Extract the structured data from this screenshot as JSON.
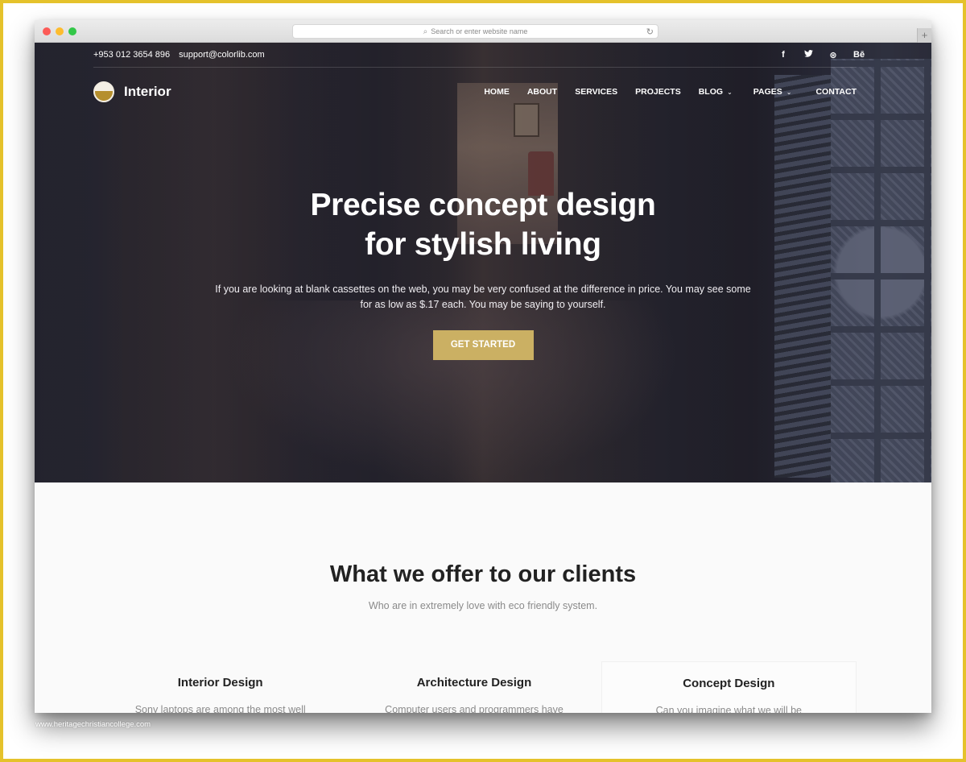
{
  "browser": {
    "url_placeholder": "Search or enter website name",
    "search_icon": "search-icon",
    "reload_icon": "reload-icon",
    "new_tab_label": "+"
  },
  "topbar": {
    "phone": "+953 012 3654 896",
    "email": "support@colorlib.com",
    "social": [
      {
        "icon": "facebook-icon",
        "glyph": "f"
      },
      {
        "icon": "twitter-icon",
        "glyph": "🐦"
      },
      {
        "icon": "dribbble-icon",
        "glyph": "⊛"
      },
      {
        "icon": "behance-icon",
        "glyph": "Bē"
      }
    ]
  },
  "navbar": {
    "brand": "Interior",
    "menu": [
      {
        "label": "Home"
      },
      {
        "label": "About"
      },
      {
        "label": "Services"
      },
      {
        "label": "Projects"
      },
      {
        "label": "Blog",
        "caret": "⌄"
      },
      {
        "label": "Pages",
        "caret": "⌄"
      },
      {
        "label": "Contact"
      }
    ]
  },
  "hero": {
    "title_line1": "Precise concept design",
    "title_line2": "for stylish living",
    "description": "If you are looking at blank cassettes on the web, you may be very confused at the difference in price. You may see some for as low as $.17 each. You may be saying to yourself.",
    "cta": "Get Started"
  },
  "offer": {
    "title": "What we offer to our clients",
    "subtitle": "Who are in extremely love with eco friendly system.",
    "cards": [
      {
        "title": "Interior Design",
        "text": "Sony laptops are among the most well"
      },
      {
        "title": "Architecture Design",
        "text": "Computer users and programmers have"
      },
      {
        "title": "Concept Design",
        "text": "Can you imagine what we will be"
      }
    ]
  },
  "watermark": "www.heritagechristiancollege.com",
  "colors": {
    "accent": "#cbb063",
    "frame": "#e5c22b",
    "heading": "#222222",
    "muted": "#8a8a8a"
  }
}
